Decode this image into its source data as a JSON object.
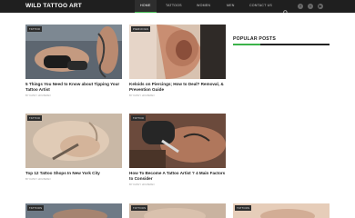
{
  "header": {
    "logo": "WILD TATTOO ART",
    "nav": [
      "HOME",
      "TATTOOS",
      "WOMEN",
      "MEN",
      "CONTACT US"
    ],
    "search_icon": "search-icon",
    "social_icons": [
      "facebook-icon",
      "twitter-icon",
      "youtube-icon"
    ],
    "accent_color": "#3bb24a"
  },
  "posts": [
    {
      "category": "TATTOO",
      "title": "5 Things You Need to Know about Tipping Your Tattoo Artist",
      "author": "BY KATHY HOUSMAN"
    },
    {
      "category": "PIERCINGS",
      "title": "Keloids on Piercings; How to Deal? Removal, & Prevention Guide",
      "author": "BY KATHY HOUSMAN"
    },
    {
      "category": "TATTOO",
      "title": "Top 12 Tattoo Shops In New York City",
      "author": "BY KATHY HOUSMAN"
    },
    {
      "category": "TATTOO",
      "title": "How To Become A Tattoo Artist ? 4 Main Factors to Consider",
      "author": "BY KATHY HOUSMAN"
    }
  ],
  "bottom_posts": [
    {
      "category": "TATTOOS"
    },
    {
      "category": "TATTOOS"
    },
    {
      "category": "TATTOOS"
    }
  ],
  "sidebar": {
    "title": "POPULAR POSTS"
  }
}
